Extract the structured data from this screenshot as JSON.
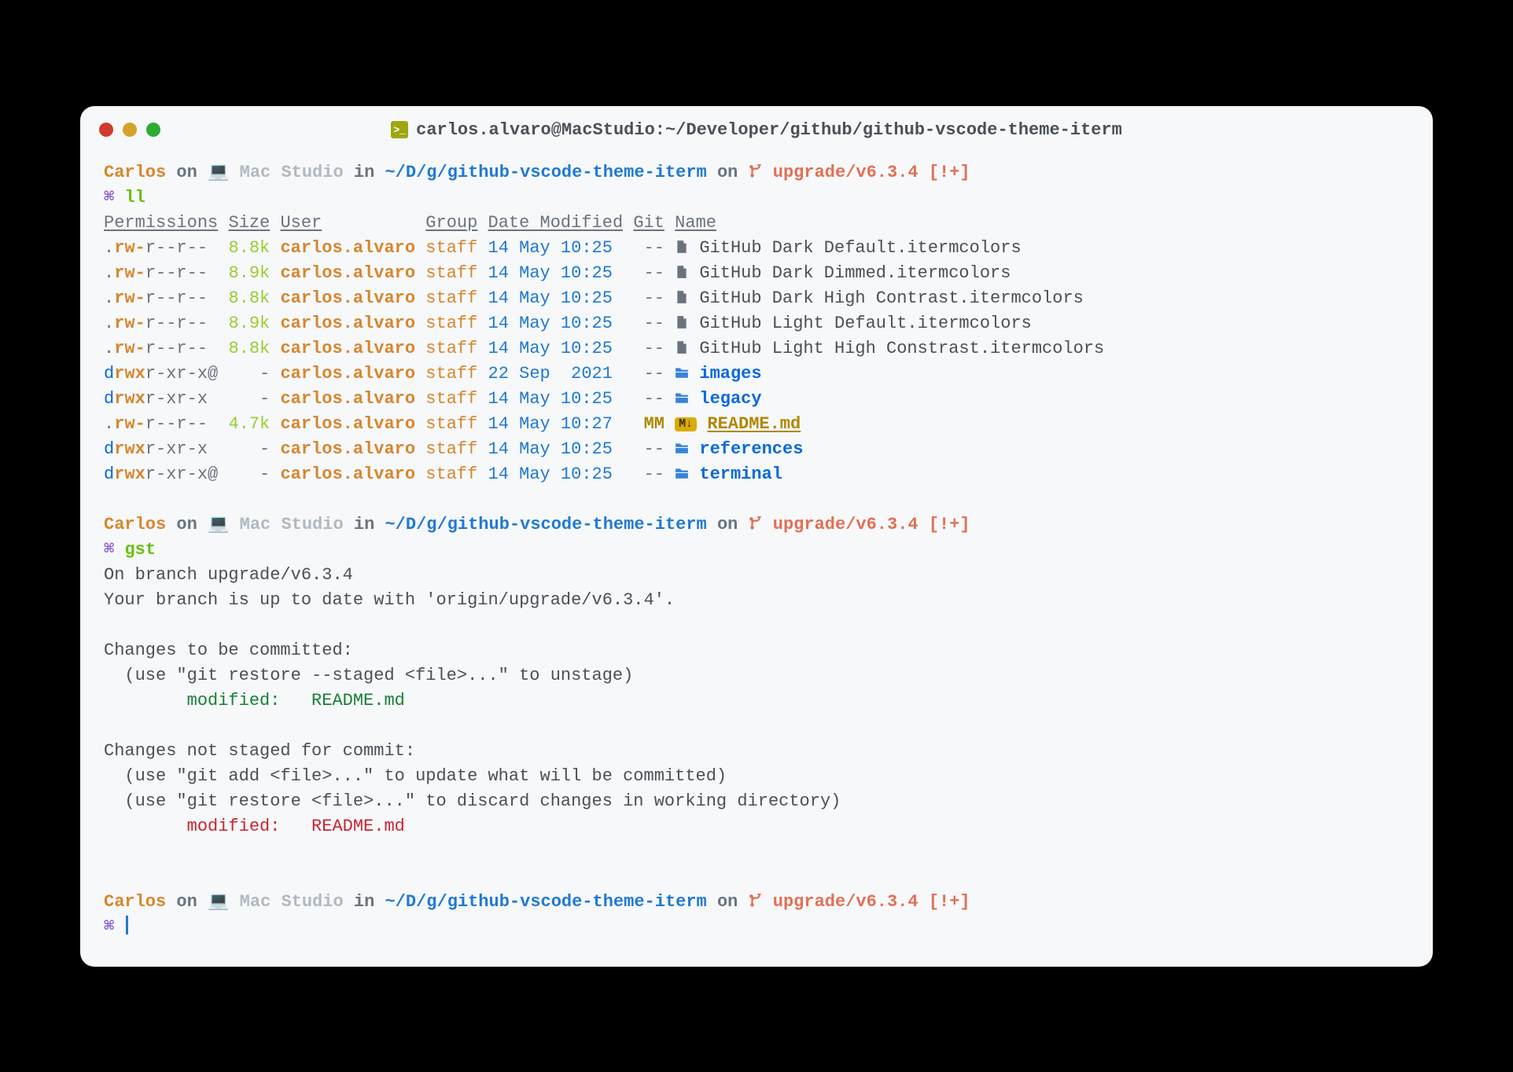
{
  "window": {
    "title": "carlos.alvaro@MacStudio:~/Developer/github/github-vscode-theme-iterm"
  },
  "prompt": {
    "user": "Carlos",
    "on": " on ",
    "host": "Mac Studio",
    "in": " in ",
    "path": "~/D/g/github-vscode-theme-iterm",
    "on2": " on ",
    "branch": "upgrade/v6.3.4",
    "dirty": " [!+]",
    "sym": "⌘ "
  },
  "commands": {
    "ll": "ll",
    "gst": "gst"
  },
  "headers": {
    "perm": "Permissions",
    "size": "Size",
    "user": "User",
    "group": "Group",
    "date": "Date Modified",
    "git": "Git",
    "name": "Name"
  },
  "rows": [
    {
      "pd": ".",
      "pr": "rw-",
      "po": "r--",
      "pg": "r--",
      "pa": " ",
      "size": "8.8k",
      "user": "carlos.alvaro",
      "group": "staff",
      "date": "14 May 10:25",
      "git": "--",
      "icon": "file",
      "name": "GitHub Dark Default.itermcolors",
      "kind": "file"
    },
    {
      "pd": ".",
      "pr": "rw-",
      "po": "r--",
      "pg": "r--",
      "pa": " ",
      "size": "8.9k",
      "user": "carlos.alvaro",
      "group": "staff",
      "date": "14 May 10:25",
      "git": "--",
      "icon": "file",
      "name": "GitHub Dark Dimmed.itermcolors",
      "kind": "file"
    },
    {
      "pd": ".",
      "pr": "rw-",
      "po": "r--",
      "pg": "r--",
      "pa": " ",
      "size": "8.8k",
      "user": "carlos.alvaro",
      "group": "staff",
      "date": "14 May 10:25",
      "git": "--",
      "icon": "file",
      "name": "GitHub Dark High Contrast.itermcolors",
      "kind": "file"
    },
    {
      "pd": ".",
      "pr": "rw-",
      "po": "r--",
      "pg": "r--",
      "pa": " ",
      "size": "8.9k",
      "user": "carlos.alvaro",
      "group": "staff",
      "date": "14 May 10:25",
      "git": "--",
      "icon": "file",
      "name": "GitHub Light Default.itermcolors",
      "kind": "file"
    },
    {
      "pd": ".",
      "pr": "rw-",
      "po": "r--",
      "pg": "r--",
      "pa": " ",
      "size": "8.8k",
      "user": "carlos.alvaro",
      "group": "staff",
      "date": "14 May 10:25",
      "git": "--",
      "icon": "file",
      "name": "GitHub Light High Constrast.itermcolors",
      "kind": "file"
    },
    {
      "pd": "d",
      "pr": "rwx",
      "po": "r-x",
      "pg": "r-x",
      "pa": "@",
      "size": "-",
      "user": "carlos.alvaro",
      "group": "staff",
      "date": "22 Sep  2021",
      "git": "--",
      "icon": "folder",
      "name": "images",
      "kind": "dir"
    },
    {
      "pd": "d",
      "pr": "rwx",
      "po": "r-x",
      "pg": "r-x",
      "pa": " ",
      "size": "-",
      "user": "carlos.alvaro",
      "group": "staff",
      "date": "14 May 10:25",
      "git": "--",
      "icon": "folder",
      "name": "legacy",
      "kind": "dir"
    },
    {
      "pd": ".",
      "pr": "rw-",
      "po": "r--",
      "pg": "r--",
      "pa": " ",
      "size": "4.7k",
      "user": "carlos.alvaro",
      "group": "staff",
      "date": "14 May 10:27",
      "git": "MM",
      "icon": "md",
      "name": "README.md",
      "kind": "md"
    },
    {
      "pd": "d",
      "pr": "rwx",
      "po": "r-x",
      "pg": "r-x",
      "pa": " ",
      "size": "-",
      "user": "carlos.alvaro",
      "group": "staff",
      "date": "14 May 10:25",
      "git": "--",
      "icon": "folder",
      "name": "references",
      "kind": "dir"
    },
    {
      "pd": "d",
      "pr": "rwx",
      "po": "r-x",
      "pg": "r-x",
      "pa": "@",
      "size": "-",
      "user": "carlos.alvaro",
      "group": "staff",
      "date": "14 May 10:25",
      "git": "--",
      "icon": "folder",
      "name": "terminal",
      "kind": "dir"
    }
  ],
  "gst": {
    "l1": "On branch upgrade/v6.3.4",
    "l2": "Your branch is up to date with 'origin/upgrade/v6.3.4'.",
    "h1": "Changes to be committed:",
    "h1s": "  (use \"git restore --staged <file>...\" to unstage)",
    "s1a": "        modified:   ",
    "s1b": "README.md",
    "h2": "Changes not staged for commit:",
    "h2s1": "  (use \"git add <file>...\" to update what will be committed)",
    "h2s2": "  (use \"git restore <file>...\" to discard changes in working directory)",
    "n1a": "        modified:   ",
    "n1b": "README.md"
  }
}
